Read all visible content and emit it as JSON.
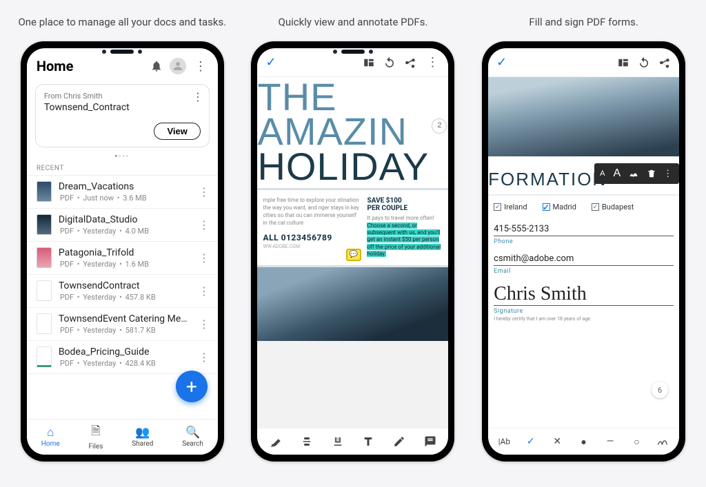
{
  "captions": {
    "c1": "One place to manage all your docs and tasks.",
    "c2": "Quickly view and annotate PDFs.",
    "c3": "Fill and sign PDF forms."
  },
  "s1": {
    "title": "Home",
    "card_from": "From Chris Smith",
    "card_name": "Townsend_Contract",
    "view_btn": "View",
    "recent_label": "RECENT",
    "items": [
      {
        "name": "Dream_Vacations",
        "type": "PDF",
        "time": "Just now",
        "size": "3.6 MB"
      },
      {
        "name": "DigitalData_Studio",
        "type": "PDF",
        "time": "Yesterday",
        "size": "4.0 MB"
      },
      {
        "name": "Patagonia_Trifold",
        "type": "PDF",
        "time": "Yesterday",
        "size": "1.6 MB"
      },
      {
        "name": "TownsendContract",
        "type": "PDF",
        "time": "Yesterday",
        "size": "457.8 KB"
      },
      {
        "name": "TownsendEvent Catering Menu",
        "type": "PDF",
        "time": "Yesterday",
        "size": "581.7 KB"
      },
      {
        "name": "Bodea_Pricing_Guide",
        "type": "PDF",
        "time": "Yesterday",
        "size": "428.4 KB"
      }
    ],
    "nav": [
      "Home",
      "Files",
      "Shared",
      "Search"
    ]
  },
  "s2": {
    "hero_l1": "THE",
    "hero_l2": "AMAZIN",
    "hero_badge": "2",
    "hero_l3": "HOLIDAY",
    "left_text": "mple free time to explore your stination the way you want, and nger stays in key cities so that ou can immerse yourself in the cal culture",
    "call": "ALL 0123456789",
    "url": "WW.ADOBE.COM",
    "save_l1": "SAVE $100",
    "save_l2": "PER COUPLE",
    "pays_pre": "It pays to travel more often! ",
    "hl": "Choose a second, or subsequent with us, and you'll get an instant $50 per person off the price of your additional holiday."
  },
  "s3": {
    "title": "FORMATION",
    "checks": [
      {
        "label": "Ireland"
      },
      {
        "label": "Madrid"
      },
      {
        "label": "Budapest"
      }
    ],
    "phone_val": "415-555-2133",
    "phone_lab": "Phone",
    "email_val": "csmith@adobe.com",
    "email_lab": "Email",
    "sig_val": "Chris Smith",
    "sig_lab": "Signature",
    "cert": "I hereby certify that I am over 18 years of age.",
    "page": "6",
    "tool_ab": "|Ab"
  }
}
